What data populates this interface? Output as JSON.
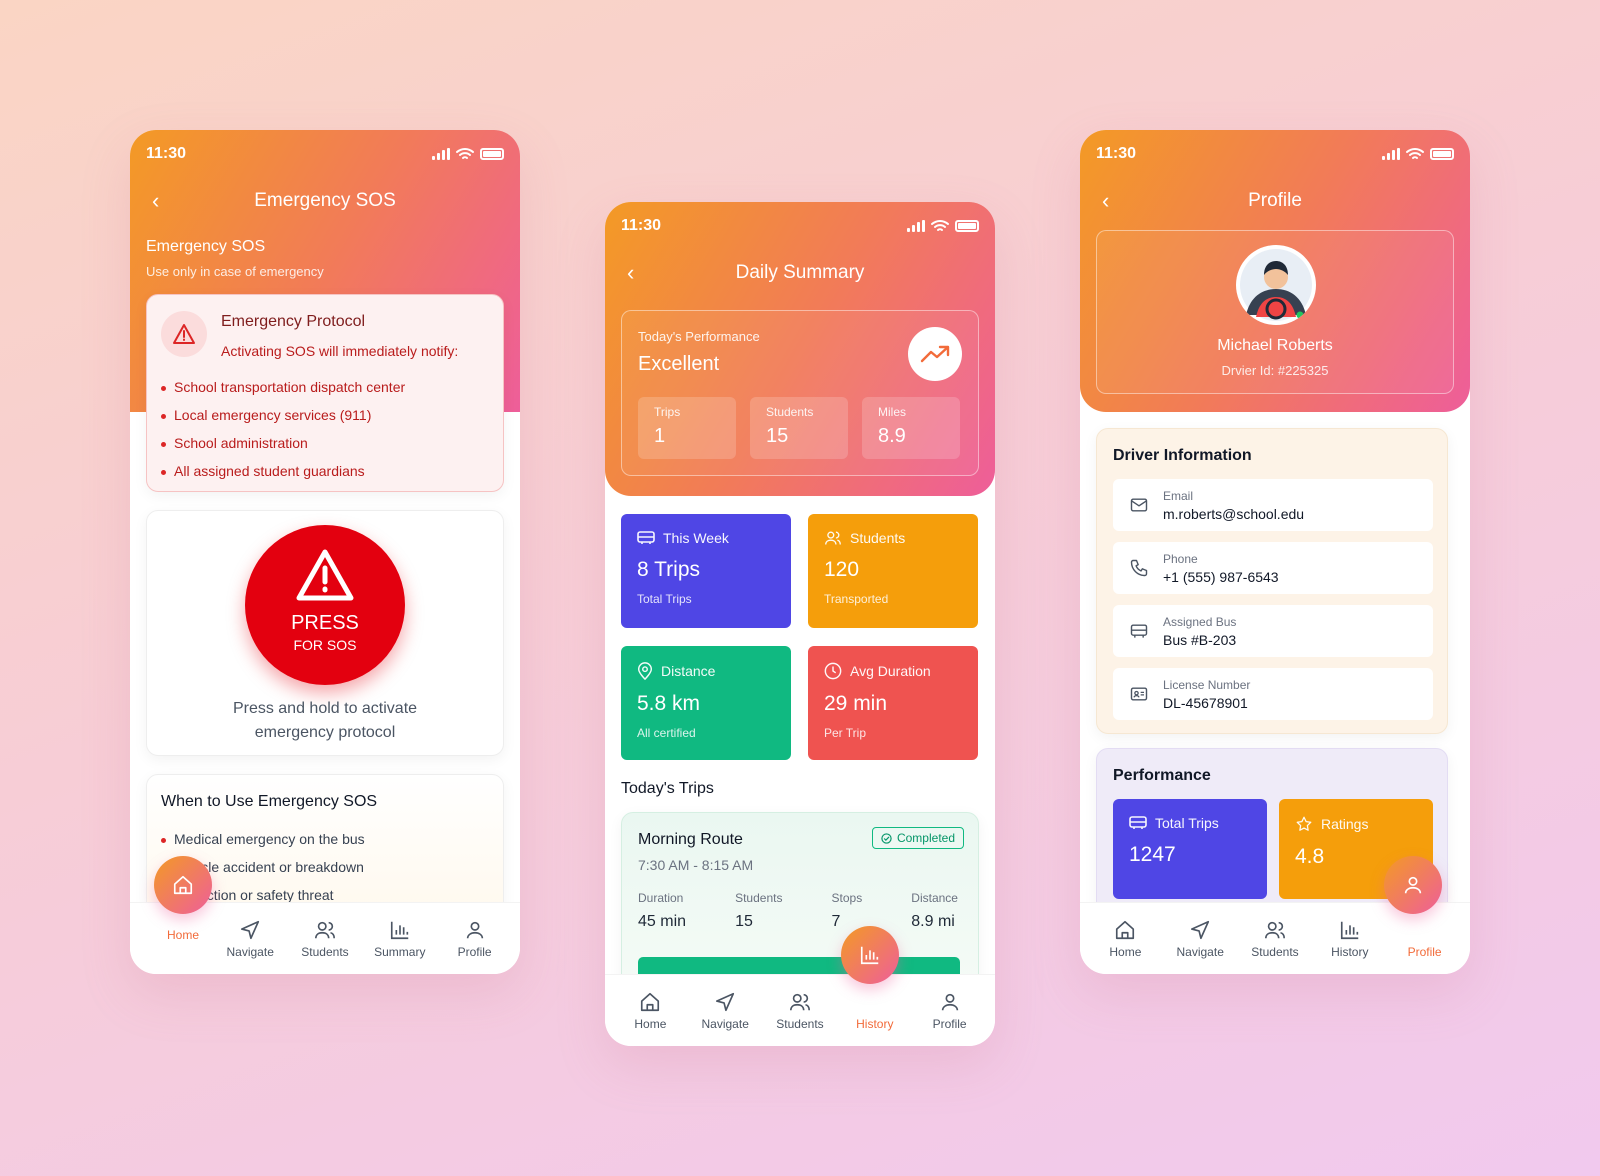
{
  "status_time": "11:30",
  "sos": {
    "title": "Emergency SOS",
    "heading": "Emergency SOS",
    "subheading": "Use only in case of emergency",
    "protocol_title": "Emergency Protocol",
    "protocol_desc": "Activating SOS will immediately notify:",
    "notify": [
      "School transportation dispatch center",
      "Local emergency services (911)",
      "School administration",
      "All assigned student guardians"
    ],
    "press_label": "PRESS",
    "press_sub": "FOR SOS",
    "hold_text": "Press and hold to activate emergency protocol",
    "when_title": "When to Use Emergency SOS",
    "when_items": [
      "Medical emergency on the bus",
      "Vehicle accident or breakdown",
      "Abduction or safety threat"
    ]
  },
  "summary": {
    "title": "Daily Summary",
    "perf_label": "Today's Performance",
    "perf_value": "Excellent",
    "minis": [
      {
        "label": "Trips",
        "value": "1"
      },
      {
        "label": "Students",
        "value": "15"
      },
      {
        "label": "Miles",
        "value": "8.9"
      }
    ],
    "stats": [
      {
        "title": "This Week",
        "value": "8 Trips",
        "sub": "Total Trips",
        "color": "#4f46e5",
        "icon": "bus-icon"
      },
      {
        "title": "Students",
        "value": "120",
        "sub": "Transported",
        "color": "#f59e0b",
        "icon": "users-icon"
      },
      {
        "title": "Distance",
        "value": "5.8 km",
        "sub": "All certified",
        "color": "#10b981",
        "icon": "location-pin-icon"
      },
      {
        "title": "Avg Duration",
        "value": "29 min",
        "sub": "Per Trip",
        "color": "#ef5350",
        "icon": "clock-icon"
      }
    ],
    "trips_title": "Today's Trips",
    "trip": {
      "name": "Morning Route",
      "time": "7:30 AM - 8:15 AM",
      "status": "Completed",
      "cols": [
        {
          "label": "Duration",
          "value": "45 min"
        },
        {
          "label": "Students",
          "value": "15"
        },
        {
          "label": "Stops",
          "value": "7"
        },
        {
          "label": "Distance",
          "value": "8.9 mi"
        }
      ]
    }
  },
  "profile": {
    "title": "Profile",
    "name": "Michael Roberts",
    "driver_id": "Drvier Id: #225325",
    "info_title": "Driver Information",
    "info": [
      {
        "label": "Email",
        "value": "m.roberts@school.edu",
        "icon": "mail-icon"
      },
      {
        "label": "Phone",
        "value": "+1 (555) 987-6543",
        "icon": "phone-icon"
      },
      {
        "label": "Assigned Bus",
        "value": "Bus #B-203",
        "icon": "bus-icon"
      },
      {
        "label": "License Number",
        "value": "DL-45678901",
        "icon": "id-card-icon"
      }
    ],
    "perf_title": "Performance",
    "perf": [
      {
        "title": "Total Trips",
        "value": "1247",
        "color": "#4f46e5",
        "icon": "bus-icon"
      },
      {
        "title": "Ratings",
        "value": "4.8",
        "color": "#f59e0b",
        "icon": "star-icon"
      }
    ]
  },
  "nav": {
    "home": "Home",
    "navigate": "Navigate",
    "students": "Students",
    "summary": "Summary",
    "history": "History",
    "profile": "Profile"
  },
  "colors": {
    "accent": "#f26b3a",
    "gradient_start": "#f39a25",
    "gradient_end": "#ee5e9a",
    "sos_red": "#e3000f"
  }
}
